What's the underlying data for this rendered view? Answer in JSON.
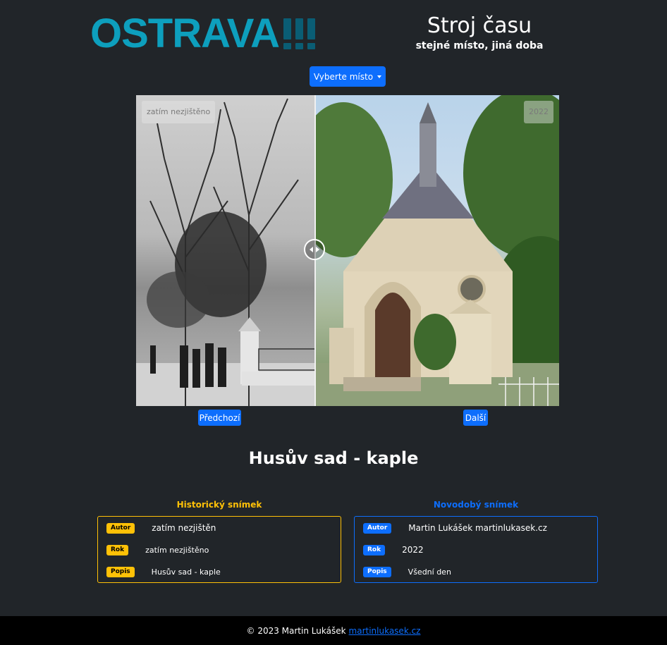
{
  "header": {
    "logo_text": "OSTRAVA",
    "title": "Stroj času",
    "subtitle": "stejné místo, jiná doba"
  },
  "place_select": {
    "label": "Vyberte místo"
  },
  "comparison": {
    "left_label": "zatím nezjištěno",
    "right_label": "2022",
    "divider_position_percent": 42.3
  },
  "navigation": {
    "prev_label": "Předchozí",
    "next_label": "Další"
  },
  "place_title": "Husův sad - kaple",
  "historic": {
    "heading": "Historický snímek",
    "rows": [
      {
        "badge": "Autor",
        "value": "zatím nezjištěn"
      },
      {
        "badge": "Rok",
        "value": "zatím nezjištěno"
      },
      {
        "badge": "Popis",
        "value": "Husův sad - kaple"
      }
    ]
  },
  "modern": {
    "heading": "Novodobý snímek",
    "rows": [
      {
        "badge": "Autor",
        "value": "Martin Lukášek martinlukasek.cz"
      },
      {
        "badge": "Rok",
        "value": "2022"
      },
      {
        "badge": "Popis",
        "value": "Všední den"
      }
    ]
  },
  "footer": {
    "text": "© 2023 Martin Lukášek",
    "link": "martinlukasek.cz"
  },
  "colors": {
    "background": "#212529",
    "accent_blue": "#0d6efd",
    "accent_yellow": "#ffc107",
    "logo": "#0d9fbd"
  }
}
